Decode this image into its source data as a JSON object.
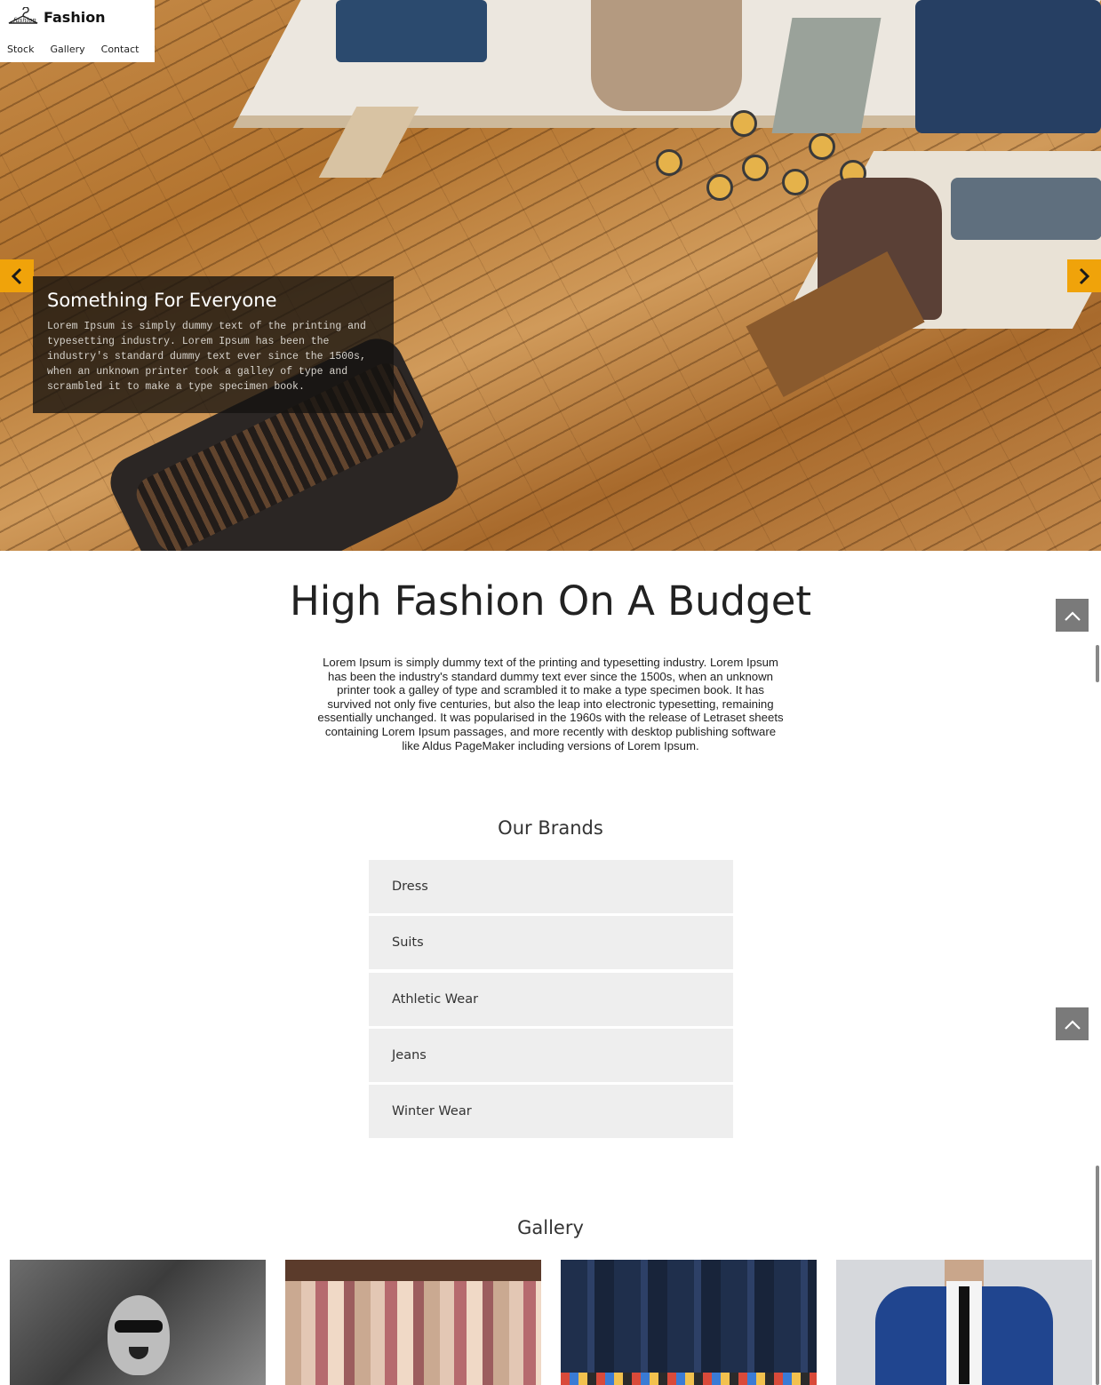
{
  "header": {
    "logo_text": "Fashion",
    "nav": [
      "Stock",
      "Gallery",
      "Contact"
    ]
  },
  "hero": {
    "caption_title": "Something For Everyone",
    "caption_text": "Lorem Ipsum is simply dummy text of the printing and typesetting industry. Lorem Ipsum has been the industry's standard dummy text ever since the 1500s, when an unknown printer took a galley of type and scrambled it to make a type specimen book.",
    "accent_color": "#f0a30a"
  },
  "main": {
    "headline": "High Fashion On A Budget",
    "intro": "Lorem Ipsum is simply dummy text of the printing and typesetting industry. Lorem Ipsum has been the industry's standard dummy text ever since the 1500s, when an unknown printer took a galley of type and scrambled it to make a type specimen book. It has survived not only five centuries, but also the leap into electronic typesetting, remaining essentially unchanged. It was popularised in the 1960s with the release of Letraset sheets containing Lorem Ipsum passages, and more recently with desktop publishing software like Aldus PageMaker including versions of Lorem Ipsum."
  },
  "brands": {
    "title": "Our Brands",
    "items": [
      "Dress",
      "Suits",
      "Athletic Wear",
      "Jeans",
      "Winter Wear"
    ]
  },
  "gallery": {
    "title": "Gallery"
  },
  "icons": {
    "prev": "chevron-left-icon",
    "next": "chevron-right-icon",
    "top": "chevron-up-icon"
  }
}
